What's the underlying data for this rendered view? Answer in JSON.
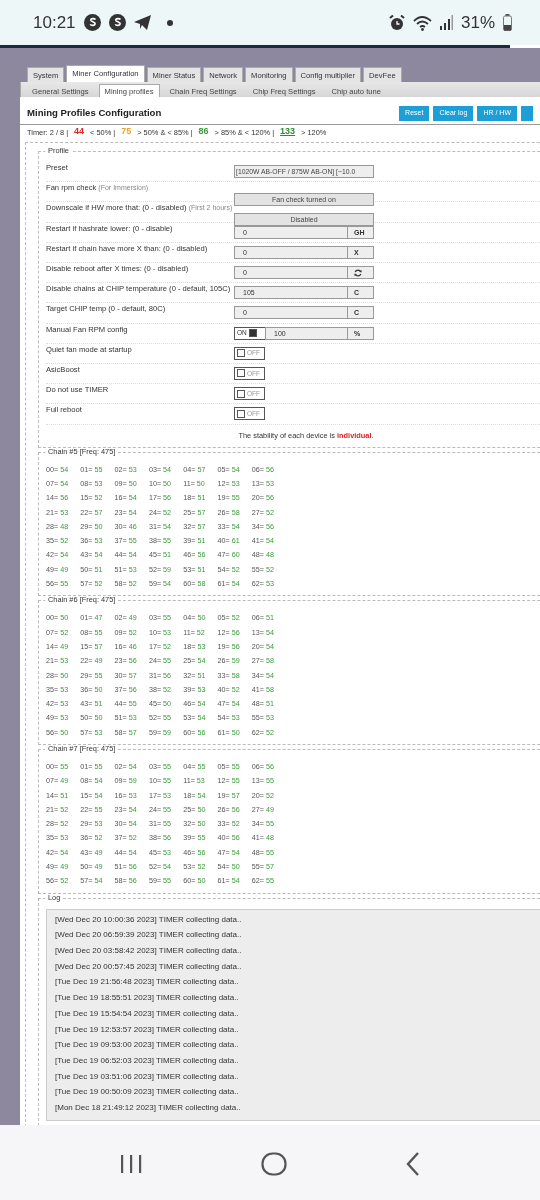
{
  "status_bar": {
    "time": "10:21",
    "battery": "31%"
  },
  "tabs": [
    {
      "label": "System",
      "selected": false
    },
    {
      "label": "Miner Configuration",
      "selected": true
    },
    {
      "label": "Miner Status",
      "selected": false
    },
    {
      "label": "Network",
      "selected": false
    },
    {
      "label": "Monitoring",
      "selected": false
    },
    {
      "label": "Config multiplier",
      "selected": false
    },
    {
      "label": "DevFee",
      "selected": false
    }
  ],
  "subtabs": [
    {
      "label": "General Settings",
      "selected": false
    },
    {
      "label": "Mining profiles",
      "selected": true
    },
    {
      "label": "Chain Freq Settings",
      "selected": false
    },
    {
      "label": "Chip Freq Settings",
      "selected": false
    },
    {
      "label": "Chip auto tune",
      "selected": false
    }
  ],
  "header": {
    "title": "Mining Profiles Configuration",
    "buttons": [
      "Reset",
      "Clear log",
      "HR / HW"
    ]
  },
  "timer": {
    "label": "Timer: 2 / 8 |",
    "legend": [
      {
        "value": "44",
        "color": "#e02424",
        "text": "< 50% |",
        "underlined": false
      },
      {
        "value": "75",
        "color": "#f0a030",
        "text": "> 50% & < 85% |",
        "underlined": false
      },
      {
        "value": "86",
        "color": "#3b9a3b",
        "text": "> 85% & < 120% |",
        "underlined": false
      },
      {
        "value": "133",
        "color": "#2e8b2e",
        "text": "> 120%",
        "underlined": true
      }
    ]
  },
  "profile": {
    "legend": "Profile",
    "rows": [
      {
        "kind": "select",
        "label": "Preset",
        "value": "[1020W AB-OFF / 875W AB-ON] [~10.0"
      },
      {
        "kind": "button",
        "label": "Fan rpm check",
        "hint": "(For Immersion)",
        "value": "Fan check turned on"
      },
      {
        "kind": "button",
        "label": "Downscale if HW more that: (0 - disabled)",
        "hint": "(First 2 hours)",
        "value": "Disabled"
      },
      {
        "kind": "input",
        "label": "Restart if hashrate lower: (0 - disable)",
        "value": "0",
        "addon": "GH"
      },
      {
        "kind": "input",
        "label": "Restart if chain have more X than: (0 - disabled)",
        "value": "0",
        "addon": "X"
      },
      {
        "kind": "input_icon",
        "label": "Disable reboot after X times: (0 - disabled)",
        "value": "0"
      },
      {
        "kind": "input",
        "label": "Disable chains at CHIP temperature (0 - default, 105C)",
        "value": "105",
        "addon": "C"
      },
      {
        "kind": "input",
        "label": "Target CHIP temp (0 - default, 80C)",
        "value": "0",
        "addon": "C"
      },
      {
        "kind": "toggle_input",
        "label": "Manual Fan RPM config",
        "on": true,
        "toggle_text": "ON",
        "value": "100",
        "addon": "%"
      },
      {
        "kind": "toggle",
        "label": "Quiet fan mode at startup",
        "on": false,
        "toggle_text": "OFF"
      },
      {
        "kind": "toggle",
        "label": "AsicBoost",
        "on": false,
        "toggle_text": "OFF"
      },
      {
        "kind": "toggle",
        "label": "Do not use TIMER",
        "on": false,
        "toggle_text": "OFF"
      },
      {
        "kind": "toggle",
        "label": "Full reboot",
        "on": false,
        "toggle_text": "OFF"
      }
    ],
    "note": "The stability of each device is **individual**."
  },
  "chains": [
    {
      "legend": "Chain #5 [Freq: 475]",
      "chips": [
        [
          "00=",
          "54"
        ],
        [
          "01=",
          "55"
        ],
        [
          "02=",
          "53"
        ],
        [
          "03=",
          "54"
        ],
        [
          "04=",
          "57"
        ],
        [
          "05=",
          "54"
        ],
        [
          "06=",
          "56"
        ],
        [
          "07=",
          "54"
        ],
        [
          "08=",
          "53"
        ],
        [
          "09=",
          "50"
        ],
        [
          "10=",
          "50"
        ],
        [
          "11=",
          "50"
        ],
        [
          "12=",
          "53"
        ],
        [
          "13=",
          "53"
        ],
        [
          "14=",
          "56"
        ],
        [
          "15=",
          "52"
        ],
        [
          "16=",
          "54"
        ],
        [
          "17=",
          "56"
        ],
        [
          "18=",
          "51"
        ],
        [
          "19=",
          "55"
        ],
        [
          "20=",
          "56"
        ],
        [
          "21=",
          "53"
        ],
        [
          "22=",
          "57"
        ],
        [
          "23=",
          "54"
        ],
        [
          "24=",
          "52"
        ],
        [
          "25=",
          "57"
        ],
        [
          "26=",
          "58"
        ],
        [
          "27=",
          "52"
        ],
        [
          "28=",
          "48"
        ],
        [
          "29=",
          "50"
        ],
        [
          "30=",
          "46"
        ],
        [
          "31=",
          "54"
        ],
        [
          "32=",
          "57"
        ],
        [
          "33=",
          "54"
        ],
        [
          "34=",
          "56"
        ],
        [
          "35=",
          "52"
        ],
        [
          "36=",
          "53"
        ],
        [
          "37=",
          "55"
        ],
        [
          "38=",
          "55"
        ],
        [
          "39=",
          "51"
        ],
        [
          "40=",
          "61"
        ],
        [
          "41=",
          "54"
        ],
        [
          "42=",
          "54"
        ],
        [
          "43=",
          "54"
        ],
        [
          "44=",
          "54"
        ],
        [
          "45=",
          "51"
        ],
        [
          "46=",
          "56"
        ],
        [
          "47=",
          "60"
        ],
        [
          "48=",
          "48"
        ],
        [
          "49=",
          "49"
        ],
        [
          "50=",
          "51"
        ],
        [
          "51=",
          "53"
        ],
        [
          "52=",
          "59"
        ],
        [
          "53=",
          "51"
        ],
        [
          "54=",
          "52"
        ],
        [
          "55=",
          "52"
        ],
        [
          "56=",
          "55"
        ],
        [
          "57=",
          "52"
        ],
        [
          "58=",
          "52"
        ],
        [
          "59=",
          "54"
        ],
        [
          "60=",
          "58"
        ],
        [
          "61=",
          "54"
        ],
        [
          "62=",
          "53"
        ]
      ]
    },
    {
      "legend": "Chain #6 [Freq: 475]",
      "chips": [
        [
          "00=",
          "50"
        ],
        [
          "01=",
          "47"
        ],
        [
          "02=",
          "49"
        ],
        [
          "03=",
          "55"
        ],
        [
          "04=",
          "50"
        ],
        [
          "05=",
          "52"
        ],
        [
          "06=",
          "51"
        ],
        [
          "07=",
          "52"
        ],
        [
          "08=",
          "55"
        ],
        [
          "09=",
          "52"
        ],
        [
          "10=",
          "53"
        ],
        [
          "11=",
          "52"
        ],
        [
          "12=",
          "56"
        ],
        [
          "13=",
          "54"
        ],
        [
          "14=",
          "49"
        ],
        [
          "15=",
          "57"
        ],
        [
          "16=",
          "46"
        ],
        [
          "17=",
          "52"
        ],
        [
          "18=",
          "53"
        ],
        [
          "19=",
          "56"
        ],
        [
          "20=",
          "54"
        ],
        [
          "21=",
          "53"
        ],
        [
          "22=",
          "49"
        ],
        [
          "23=",
          "56"
        ],
        [
          "24=",
          "55"
        ],
        [
          "25=",
          "54"
        ],
        [
          "26=",
          "59"
        ],
        [
          "27=",
          "58"
        ],
        [
          "28=",
          "50"
        ],
        [
          "29=",
          "55"
        ],
        [
          "30=",
          "57"
        ],
        [
          "31=",
          "56"
        ],
        [
          "32=",
          "51"
        ],
        [
          "33=",
          "58"
        ],
        [
          "34=",
          "54"
        ],
        [
          "35=",
          "53"
        ],
        [
          "36=",
          "50"
        ],
        [
          "37=",
          "56"
        ],
        [
          "38=",
          "52"
        ],
        [
          "39=",
          "53"
        ],
        [
          "40=",
          "52"
        ],
        [
          "41=",
          "58"
        ],
        [
          "42=",
          "53"
        ],
        [
          "43=",
          "51"
        ],
        [
          "44=",
          "55"
        ],
        [
          "45=",
          "50"
        ],
        [
          "46=",
          "54"
        ],
        [
          "47=",
          "54"
        ],
        [
          "48=",
          "51"
        ],
        [
          "49=",
          "53"
        ],
        [
          "50=",
          "50"
        ],
        [
          "51=",
          "53"
        ],
        [
          "52=",
          "55"
        ],
        [
          "53=",
          "54"
        ],
        [
          "54=",
          "53"
        ],
        [
          "55=",
          "53"
        ],
        [
          "56=",
          "50"
        ],
        [
          "57=",
          "53"
        ],
        [
          "58=",
          "57"
        ],
        [
          "59=",
          "59"
        ],
        [
          "60=",
          "56"
        ],
        [
          "61=",
          "50"
        ],
        [
          "62=",
          "52"
        ]
      ]
    },
    {
      "legend": "Chain #7 [Freq: 475]",
      "chips": [
        [
          "00=",
          "55"
        ],
        [
          "01=",
          "55"
        ],
        [
          "02=",
          "54"
        ],
        [
          "03=",
          "55"
        ],
        [
          "04=",
          "55"
        ],
        [
          "05=",
          "55"
        ],
        [
          "06=",
          "56"
        ],
        [
          "07=",
          "49"
        ],
        [
          "08=",
          "54"
        ],
        [
          "09=",
          "59"
        ],
        [
          "10=",
          "55"
        ],
        [
          "11=",
          "53"
        ],
        [
          "12=",
          "55"
        ],
        [
          "13=",
          "55"
        ],
        [
          "14=",
          "51"
        ],
        [
          "15=",
          "54"
        ],
        [
          "16=",
          "53"
        ],
        [
          "17=",
          "53"
        ],
        [
          "18=",
          "54"
        ],
        [
          "19=",
          "57"
        ],
        [
          "20=",
          "52"
        ],
        [
          "21=",
          "52"
        ],
        [
          "22=",
          "55"
        ],
        [
          "23=",
          "54"
        ],
        [
          "24=",
          "55"
        ],
        [
          "25=",
          "50"
        ],
        [
          "26=",
          "56"
        ],
        [
          "27=",
          "49"
        ],
        [
          "28=",
          "52"
        ],
        [
          "29=",
          "53"
        ],
        [
          "30=",
          "54"
        ],
        [
          "31=",
          "55"
        ],
        [
          "32=",
          "50"
        ],
        [
          "33=",
          "52"
        ],
        [
          "34=",
          "55"
        ],
        [
          "35=",
          "53"
        ],
        [
          "36=",
          "52"
        ],
        [
          "37=",
          "52"
        ],
        [
          "38=",
          "56"
        ],
        [
          "39=",
          "55"
        ],
        [
          "40=",
          "56"
        ],
        [
          "41=",
          "48"
        ],
        [
          "42=",
          "54"
        ],
        [
          "43=",
          "49"
        ],
        [
          "44=",
          "54"
        ],
        [
          "45=",
          "53"
        ],
        [
          "46=",
          "56"
        ],
        [
          "47=",
          "54"
        ],
        [
          "48=",
          "55"
        ],
        [
          "49=",
          "49"
        ],
        [
          "50=",
          "49"
        ],
        [
          "51=",
          "56"
        ],
        [
          "52=",
          "54"
        ],
        [
          "53=",
          "52"
        ],
        [
          "54=",
          "50"
        ],
        [
          "55=",
          "57"
        ],
        [
          "56=",
          "52"
        ],
        [
          "57=",
          "54"
        ],
        [
          "58=",
          "56"
        ],
        [
          "59=",
          "55"
        ],
        [
          "60=",
          "50"
        ],
        [
          "61=",
          "54"
        ],
        [
          "62=",
          "55"
        ]
      ]
    }
  ],
  "log": {
    "legend": "Log",
    "lines": [
      "[Wed Dec 20 10:00:36 2023] TIMER collecting data..",
      "[Wed Dec 20 06:59:39 2023] TIMER collecting data..",
      "[Wed Dec 20 03:58:42 2023] TIMER collecting data..",
      "[Wed Dec 20 00:57:45 2023] TIMER collecting data..",
      "[Tue Dec 19 21:56:48 2023] TIMER collecting data..",
      "[Tue Dec 19 18:55:51 2023] TIMER collecting data..",
      "[Tue Dec 19 15:54:54 2023] TIMER collecting data..",
      "[Tue Dec 19 12:53:57 2023] TIMER collecting data..",
      "[Tue Dec 19 09:53:00 2023] TIMER collecting data..",
      "[Tue Dec 19 06:52:03 2023] TIMER collecting data..",
      "[Tue Dec 19 03:51:06 2023] TIMER collecting data..",
      "[Tue Dec 19 00:50:09 2023] TIMER collecting data..",
      "[Mon Dec 18 21:49:12 2023] TIMER collecting data.."
    ]
  }
}
